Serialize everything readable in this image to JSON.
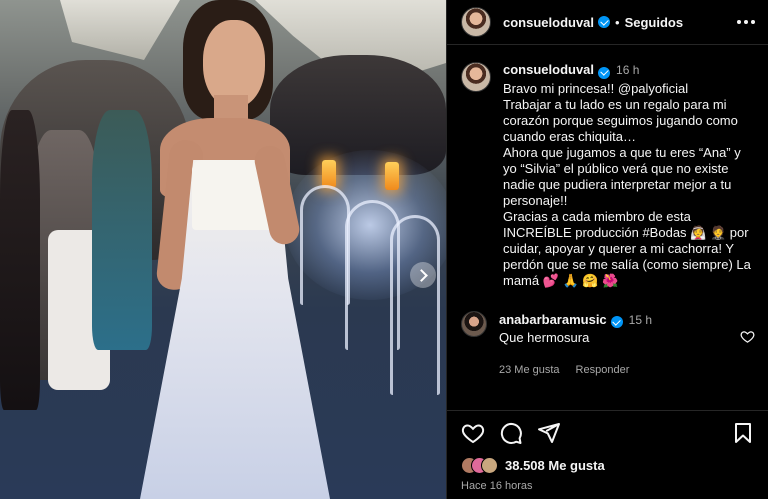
{
  "post": {
    "username": "consueloduval",
    "follow_status": "Seguidos",
    "time": "16 h",
    "caption": "Bravo mi princesa!! @palyoficial\nTrabajar a tu lado es un regalo para mi corazón porque seguimos jugando como cuando eras chiquita…\nAhora que jugamos a que tu eres “Ana” y yo “Silvia” el público verá que no existe nadie que pudiera interpretar mejor a tu personaje!!\nGracias a cada miembro de esta INCREÍBLE producción #Bodas 👰 🤵 por cuidar, apoyar y querer a mi cachorra! Y perdón que se me salía (como siempre) La mamá 💕 🙏 🤗 🌺",
    "likes": "38.508 Me gusta",
    "ago": "Hace 16 horas"
  },
  "comments": [
    {
      "username": "anabarbaramusic",
      "time": "15 h",
      "text": "Que hermosura",
      "likes": "23 Me gusta",
      "reply": "Responder"
    }
  ],
  "icons": [
    "more-icon",
    "verified-icon",
    "heart-icon",
    "comment-icon",
    "share-icon",
    "save-icon",
    "next-icon"
  ]
}
